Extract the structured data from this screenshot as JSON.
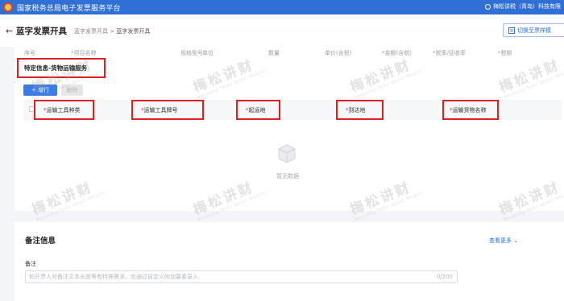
{
  "app": {
    "title": "国家税务总局电子发票服务平台",
    "user": "梅松讲税（青岛）科技有限"
  },
  "header": {
    "back_icon": "back-arrow-icon",
    "page_title": "蓝字发票开具",
    "breadcrumb": [
      "蓝字发票开具",
      "蓝字发票开具"
    ],
    "breadcrumb_sep": ">",
    "switch_button": "切换至票样模"
  },
  "goods_table": {
    "columns": [
      "序号",
      "*项目名称",
      "规格型号",
      "单位",
      "数量",
      "单价(含税)",
      "*金额(含税)",
      "*税率/征收率",
      "*税额"
    ]
  },
  "special_info": {
    "title": "特定信息-货物运输服务",
    "add_button": "+ 增行",
    "delete_button": "删除",
    "columns": [
      {
        "req": "*",
        "label": "运输工具种类"
      },
      {
        "req": "*",
        "label": "运输工具牌号"
      },
      {
        "req": "*",
        "label": "起运地"
      },
      {
        "req": "*",
        "label": "到达地"
      },
      {
        "req": "*",
        "label": "运输货物名称"
      }
    ],
    "empty_text": "暂无数据"
  },
  "remarks": {
    "title": "备注信息",
    "more": "查看更多",
    "label": "备注",
    "placeholder": "如开票人对备注文本长度等有特殊需求，应通过自定义附加要素录入",
    "counter": "0/200"
  },
  "watermark": {
    "text": "梅松讲财",
    "sub": "Meysong Talks about Wealth"
  },
  "colors": {
    "brand": "#2f6fd6",
    "highlight": "#e02020",
    "primary_button": "#3a7be8"
  }
}
